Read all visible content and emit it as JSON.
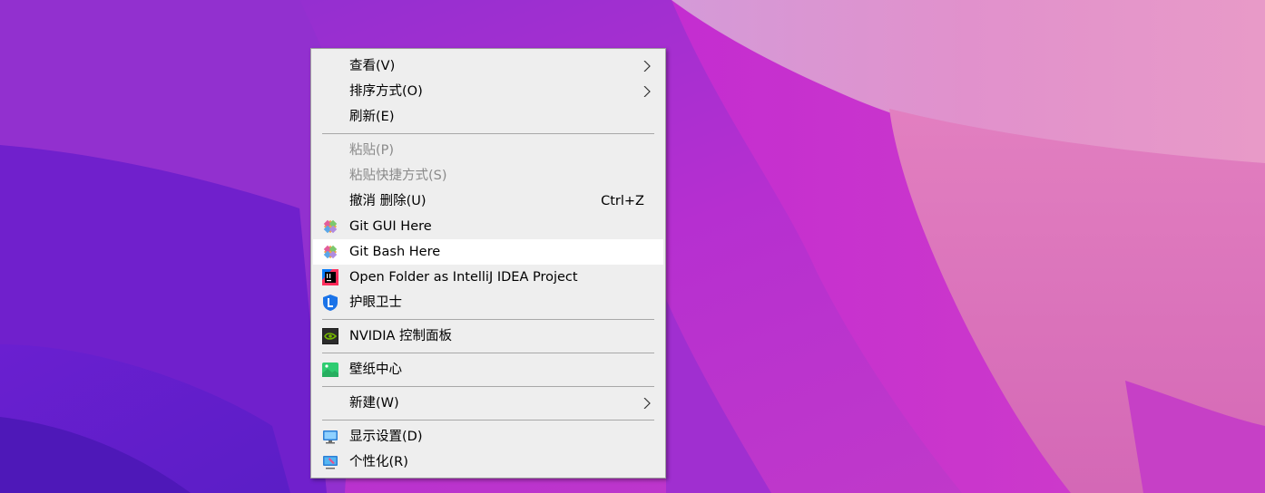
{
  "menu": {
    "view": {
      "label": "查看(V)"
    },
    "sort": {
      "label": "排序方式(O)"
    },
    "refresh": {
      "label": "刷新(E)"
    },
    "paste": {
      "label": "粘贴(P)"
    },
    "paste_shortcut": {
      "label": "粘贴快捷方式(S)"
    },
    "undo_delete": {
      "label": "撤消 删除(U)",
      "shortcut": "Ctrl+Z"
    },
    "git_gui": {
      "label": "Git GUI Here"
    },
    "git_bash": {
      "label": "Git Bash Here"
    },
    "intellij": {
      "label": "Open Folder as IntelliJ IDEA Project"
    },
    "eye_guard": {
      "label": "护眼卫士"
    },
    "nvidia": {
      "label": "NVIDIA 控制面板"
    },
    "wallpaper_center": {
      "label": "壁纸中心"
    },
    "new": {
      "label": "新建(W)"
    },
    "display_settings": {
      "label": "显示设置(D)"
    },
    "personalize": {
      "label": "个性化(R)"
    }
  },
  "colors": {
    "menu_bg": "#eeeeee",
    "highlight": "#ffffff",
    "disabled_text": "#8a8a8a"
  }
}
